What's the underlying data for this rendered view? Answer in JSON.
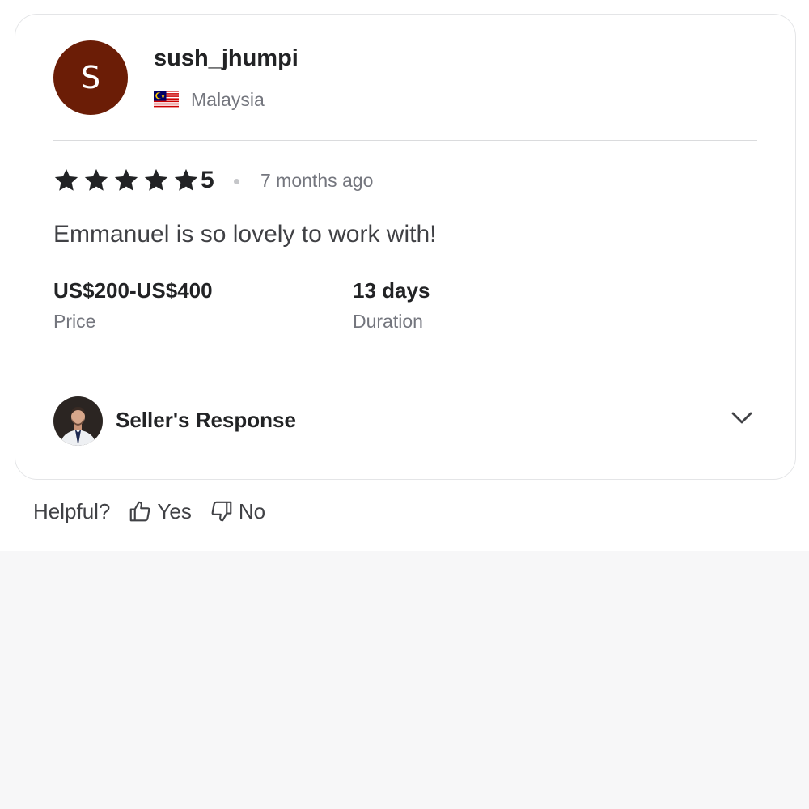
{
  "review": {
    "avatar_initial": "S",
    "username": "sush_jhumpi",
    "country": "Malaysia",
    "rating": "5",
    "rating_stars": 5,
    "time_ago": "7 months ago",
    "text": "Emmanuel is so lovely to work with!",
    "price_value": "US$200-US$400",
    "price_label": "Price",
    "duration_value": "13 days",
    "duration_label": "Duration"
  },
  "seller_response": {
    "title": "Seller's Response"
  },
  "helpful": {
    "label": "Helpful?",
    "yes_label": "Yes",
    "no_label": "No"
  },
  "colors": {
    "avatar_bg": "#6b1d06",
    "text_dark": "#222325",
    "text_muted": "#74767e",
    "star": "#222325",
    "page_bg": "#f7f7f8"
  },
  "icons": [
    "star-icon",
    "malaysia-flag-icon",
    "chevron-down-icon",
    "thumbs-up-icon",
    "thumbs-down-icon"
  ]
}
